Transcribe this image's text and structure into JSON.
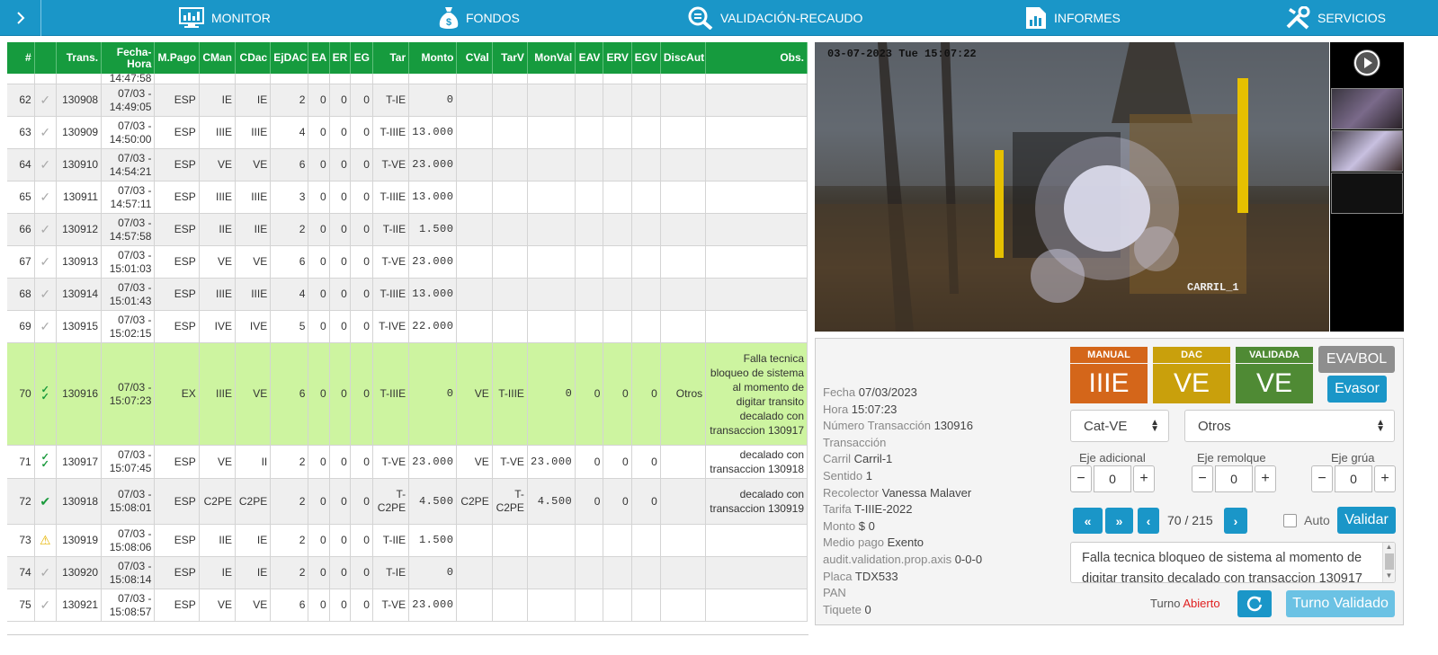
{
  "nav": {
    "items": [
      {
        "label": "MONITOR",
        "icon": "monitor-icon"
      },
      {
        "label": "FONDOS",
        "icon": "money-bag-icon"
      },
      {
        "label": "VALIDACIÓN-RECAUDO",
        "icon": "search-validation-icon"
      },
      {
        "label": "INFORMES",
        "icon": "report-chart-icon"
      },
      {
        "label": "SERVICIOS",
        "icon": "tools-icon"
      }
    ]
  },
  "table": {
    "headers": [
      "#",
      "",
      "Trans.",
      "Fecha-Hora",
      "M.Pago",
      "CMan",
      "CDac",
      "EjDAC",
      "EA",
      "ER",
      "EG",
      "Tar",
      "Monto",
      "CVal",
      "TarV",
      "MonVal",
      "EAV",
      "ERV",
      "EGV",
      "DiscAut",
      "Obs."
    ],
    "partial_top": {
      "time": "14:47:58"
    },
    "rows": [
      {
        "n": "62",
        "status": "check-grey",
        "trans": "130908",
        "date": "07/03 -",
        "time": "14:49:05",
        "mpago": "ESP",
        "cman": "IE",
        "cdac": "IE",
        "ejdac": "2",
        "ea": "0",
        "er": "0",
        "eg": "0",
        "tar": "T-IE",
        "monto": "0",
        "cval": "",
        "tarv": "",
        "monval": "",
        "eav": "",
        "erv": "",
        "egv": "",
        "disc": "",
        "obs": ""
      },
      {
        "n": "63",
        "status": "check-grey",
        "trans": "130909",
        "date": "07/03 -",
        "time": "14:50:00",
        "mpago": "ESP",
        "cman": "IIIE",
        "cdac": "IIIE",
        "ejdac": "4",
        "ea": "0",
        "er": "0",
        "eg": "0",
        "tar": "T-IIIE",
        "monto": "13.000",
        "cval": "",
        "tarv": "",
        "monval": "",
        "eav": "",
        "erv": "",
        "egv": "",
        "disc": "",
        "obs": ""
      },
      {
        "n": "64",
        "status": "check-grey",
        "trans": "130910",
        "date": "07/03 -",
        "time": "14:54:21",
        "mpago": "ESP",
        "cman": "VE",
        "cdac": "VE",
        "ejdac": "6",
        "ea": "0",
        "er": "0",
        "eg": "0",
        "tar": "T-VE",
        "monto": "23.000",
        "cval": "",
        "tarv": "",
        "monval": "",
        "eav": "",
        "erv": "",
        "egv": "",
        "disc": "",
        "obs": ""
      },
      {
        "n": "65",
        "status": "check-grey",
        "trans": "130911",
        "date": "07/03 -",
        "time": "14:57:11",
        "mpago": "ESP",
        "cman": "IIIE",
        "cdac": "IIIE",
        "ejdac": "3",
        "ea": "0",
        "er": "0",
        "eg": "0",
        "tar": "T-IIIE",
        "monto": "13.000",
        "cval": "",
        "tarv": "",
        "monval": "",
        "eav": "",
        "erv": "",
        "egv": "",
        "disc": "",
        "obs": ""
      },
      {
        "n": "66",
        "status": "check-grey",
        "trans": "130912",
        "date": "07/03 -",
        "time": "14:57:58",
        "mpago": "ESP",
        "cman": "IIE",
        "cdac": "IIE",
        "ejdac": "2",
        "ea": "0",
        "er": "0",
        "eg": "0",
        "tar": "T-IIE",
        "monto": "1.500",
        "cval": "",
        "tarv": "",
        "monval": "",
        "eav": "",
        "erv": "",
        "egv": "",
        "disc": "",
        "obs": ""
      },
      {
        "n": "67",
        "status": "check-grey",
        "trans": "130913",
        "date": "07/03 -",
        "time": "15:01:03",
        "mpago": "ESP",
        "cman": "VE",
        "cdac": "VE",
        "ejdac": "6",
        "ea": "0",
        "er": "0",
        "eg": "0",
        "tar": "T-VE",
        "monto": "23.000",
        "cval": "",
        "tarv": "",
        "monval": "",
        "eav": "",
        "erv": "",
        "egv": "",
        "disc": "",
        "obs": ""
      },
      {
        "n": "68",
        "status": "check-grey",
        "trans": "130914",
        "date": "07/03 -",
        "time": "15:01:43",
        "mpago": "ESP",
        "cman": "IIIE",
        "cdac": "IIIE",
        "ejdac": "4",
        "ea": "0",
        "er": "0",
        "eg": "0",
        "tar": "T-IIIE",
        "monto": "13.000",
        "cval": "",
        "tarv": "",
        "monval": "",
        "eav": "",
        "erv": "",
        "egv": "",
        "disc": "",
        "obs": ""
      },
      {
        "n": "69",
        "status": "check-grey",
        "trans": "130915",
        "date": "07/03 -",
        "time": "15:02:15",
        "mpago": "ESP",
        "cman": "IVE",
        "cdac": "IVE",
        "ejdac": "5",
        "ea": "0",
        "er": "0",
        "eg": "0",
        "tar": "T-IVE",
        "monto": "22.000",
        "cval": "",
        "tarv": "",
        "monval": "",
        "eav": "",
        "erv": "",
        "egv": "",
        "disc": "",
        "obs": ""
      },
      {
        "n": "70",
        "status": "double-check-green",
        "trans": "130916",
        "date": "07/03 -",
        "time": "15:07:23",
        "mpago": "EX",
        "cman": "IIIE",
        "cdac": "VE",
        "ejdac": "6",
        "ea": "0",
        "er": "0",
        "eg": "0",
        "tar": "T-IIIE",
        "monto": "0",
        "cval": "VE",
        "tarv": "T-IIIE",
        "monval": "0",
        "eav": "0",
        "erv": "0",
        "egv": "0",
        "disc": "Otros",
        "obs": "Falla tecnica bloqueo de sistema al momento de digitar transito decalado con transaccion 130917"
      },
      {
        "n": "71",
        "status": "double-check-green",
        "trans": "130917",
        "date": "07/03 -",
        "time": "15:07:45",
        "mpago": "ESP",
        "cman": "VE",
        "cdac": "II",
        "ejdac": "2",
        "ea": "0",
        "er": "0",
        "eg": "0",
        "tar": "T-VE",
        "monto": "23.000",
        "cval": "VE",
        "tarv": "T-VE",
        "monval": "23.000",
        "eav": "0",
        "erv": "0",
        "egv": "0",
        "disc": "",
        "obs": "decalado con transaccion 130918"
      },
      {
        "n": "72",
        "status": "check-green",
        "trans": "130918",
        "date": "07/03 -",
        "time": "15:08:01",
        "mpago": "ESP",
        "cman": "C2PE",
        "cdac": "C2PE",
        "ejdac": "2",
        "ea": "0",
        "er": "0",
        "eg": "0",
        "tar": "T-C2PE",
        "monto": "4.500",
        "cval": "C2PE",
        "tarv": "T-C2PE",
        "monval": "4.500",
        "eav": "0",
        "erv": "0",
        "egv": "0",
        "disc": "",
        "obs": "decalado con transaccion 130919"
      },
      {
        "n": "73",
        "status": "warning",
        "trans": "130919",
        "date": "07/03 -",
        "time": "15:08:06",
        "mpago": "ESP",
        "cman": "IIE",
        "cdac": "IE",
        "ejdac": "2",
        "ea": "0",
        "er": "0",
        "eg": "0",
        "tar": "T-IIE",
        "monto": "1.500",
        "cval": "",
        "tarv": "",
        "monval": "",
        "eav": "",
        "erv": "",
        "egv": "",
        "disc": "",
        "obs": ""
      },
      {
        "n": "74",
        "status": "check-grey",
        "trans": "130920",
        "date": "07/03 -",
        "time": "15:08:14",
        "mpago": "ESP",
        "cman": "IE",
        "cdac": "IE",
        "ejdac": "2",
        "ea": "0",
        "er": "0",
        "eg": "0",
        "tar": "T-IE",
        "monto": "0",
        "cval": "",
        "tarv": "",
        "monval": "",
        "eav": "",
        "erv": "",
        "egv": "",
        "disc": "",
        "obs": ""
      },
      {
        "n": "75",
        "status": "check-grey",
        "trans": "130921",
        "date": "07/03 -",
        "time": "15:08:57",
        "mpago": "ESP",
        "cman": "VE",
        "cdac": "VE",
        "ejdac": "6",
        "ea": "0",
        "er": "0",
        "eg": "0",
        "tar": "T-VE",
        "monto": "23.000",
        "cval": "",
        "tarv": "",
        "monval": "",
        "eav": "",
        "erv": "",
        "egv": "",
        "disc": "",
        "obs": ""
      }
    ]
  },
  "camera": {
    "timestamp": "03-07-2023 Tue 15:07:22",
    "lane": "CARRIL_1"
  },
  "info": {
    "fields": [
      {
        "label": "Fecha",
        "value": "07/03/2023"
      },
      {
        "label": "Hora",
        "value": "15:07:23"
      },
      {
        "label": "Número Transacción",
        "value": "130916"
      },
      {
        "label": "Transacción",
        "value": ""
      },
      {
        "label": "Carril",
        "value": "Carril-1"
      },
      {
        "label": "Sentido",
        "value": "1"
      },
      {
        "label": "Recolector",
        "value": "Vanessa Malaver"
      },
      {
        "label": "Tarifa",
        "value": "T-IIIE-2022"
      },
      {
        "label": "Monto",
        "value": "$ 0"
      },
      {
        "label": "Medio pago",
        "value": "Exento"
      },
      {
        "label": "audit.validation.prop.axis",
        "value": "0-0-0"
      },
      {
        "label": "Placa",
        "value": "TDX533"
      },
      {
        "label": "PAN",
        "value": ""
      },
      {
        "label": "Tiquete",
        "value": "0"
      }
    ]
  },
  "categories": {
    "manual": {
      "label": "MANUAL",
      "value": "IIIE",
      "color": "#d4661a"
    },
    "dac": {
      "label": "DAC",
      "value": "VE",
      "color": "#c9a00c"
    },
    "validada": {
      "label": "VALIDADA",
      "value": "VE",
      "color": "#4f8a34"
    }
  },
  "actions": {
    "eva_bol": "EVA/BOL",
    "evasor": "Evasor",
    "validar": "Validar",
    "turno_validado": "Turno Validado"
  },
  "selects": {
    "cat": "Cat-VE",
    "motivo": "Otros"
  },
  "steppers": [
    {
      "label": "Eje adicional",
      "value": "0"
    },
    {
      "label": "Eje remolque",
      "value": "0"
    },
    {
      "label": "Eje grúa",
      "value": "0"
    }
  ],
  "pager": {
    "current": "70",
    "total": "/ 215"
  },
  "auto_label": "Auto",
  "notes": "Falla tecnica bloqueo de sistema al momento de digitar transito decalado con transaccion 130917",
  "turno": {
    "label": "Turno",
    "status": "Abierto"
  },
  "colors": {
    "primary": "#1a96c8",
    "header_green": "#169b3e",
    "selected_row": "#cdf4a0",
    "abierto": "#e02020"
  }
}
